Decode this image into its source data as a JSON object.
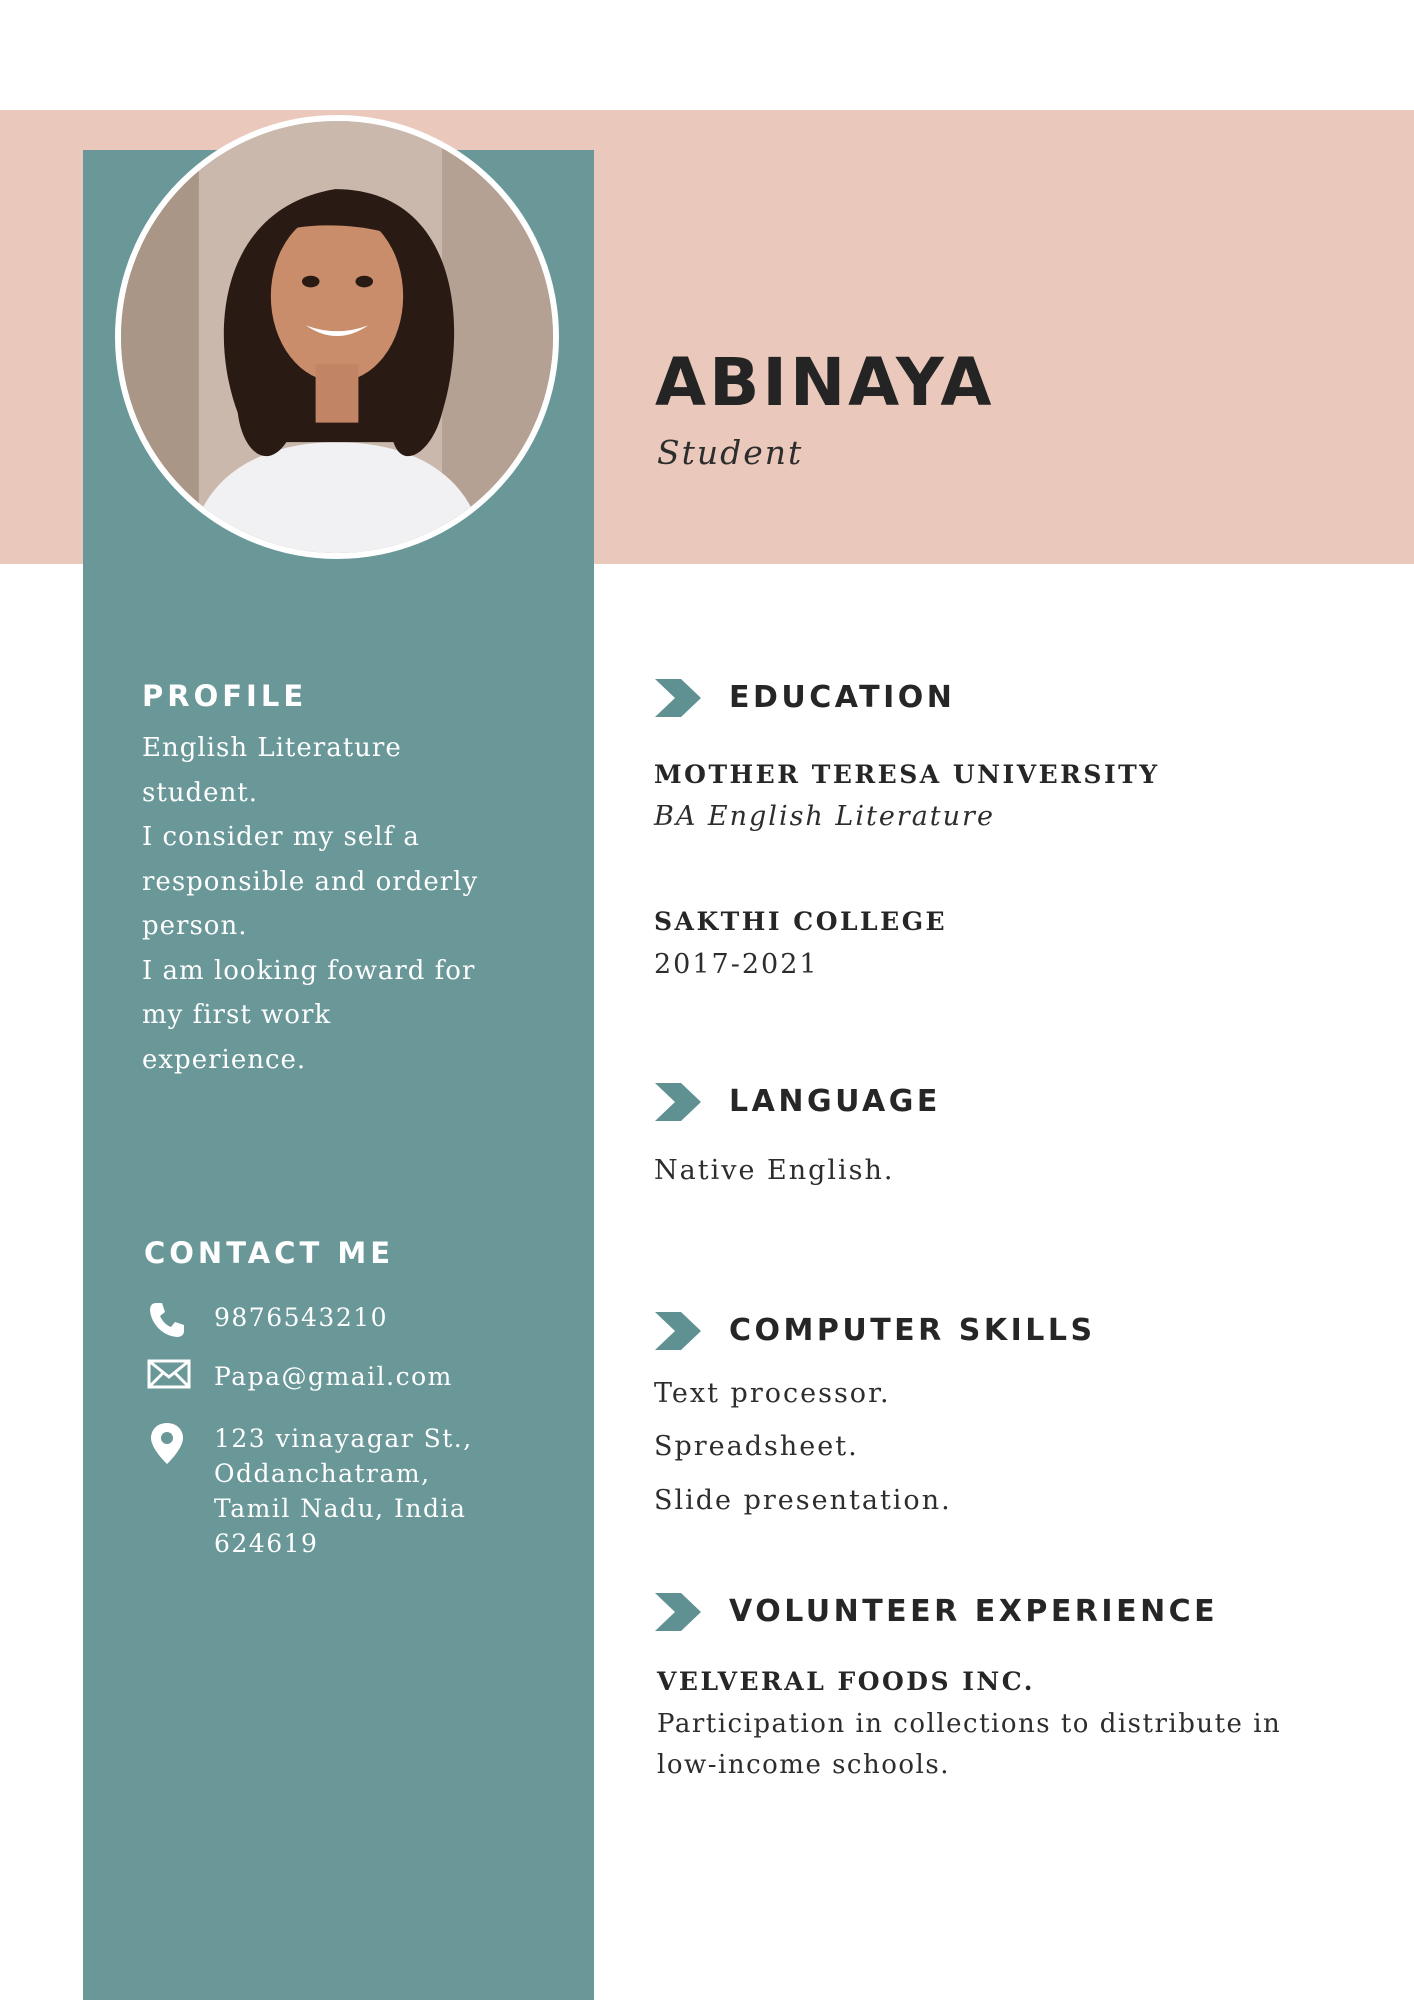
{
  "header": {
    "name": "ABINAYA",
    "role": "Student"
  },
  "photo": {
    "alt": "portrait photo"
  },
  "profile": {
    "heading": "PROFILE",
    "lines": [
      "English Literature",
      "student.",
      "I consider my self a",
      "responsible and orderly",
      "person.",
      "I am looking foward for",
      "my first work",
      "experience."
    ]
  },
  "contact": {
    "heading": "CONTACT ME",
    "phone": "9876543210",
    "email": "Papa@gmail.com",
    "address_lines": [
      "123 vinayagar St.,",
      "Oddanchatram,",
      "Tamil Nadu, India",
      "624619"
    ]
  },
  "education": {
    "heading": "EDUCATION",
    "items": [
      {
        "title": "MOTHER TERESA UNIVERSITY",
        "detail": "BA English Literature"
      },
      {
        "title": "SAKTHI COLLEGE",
        "detail": "2017-2021"
      }
    ]
  },
  "language": {
    "heading": "LANGUAGE",
    "text": "Native English."
  },
  "computer_skills": {
    "heading": "COMPUTER SKILLS",
    "items": [
      "Text processor.",
      "Spreadsheet.",
      "Slide presentation."
    ]
  },
  "volunteer": {
    "heading": "VOLUNTEER EXPERIENCE",
    "org": "VELVERAL FOODS INC.",
    "desc_lines": [
      "Participation in collections to distribute in",
      "low-income schools."
    ]
  },
  "colors": {
    "band": "#eac8bb",
    "sidebar": "#6a9798",
    "accent": "#5f9192",
    "text_dark": "#262626"
  },
  "icons": {
    "phone": "phone-icon",
    "email": "envelope-icon",
    "address": "map-pin-icon",
    "section": "chevron-right-icon"
  }
}
